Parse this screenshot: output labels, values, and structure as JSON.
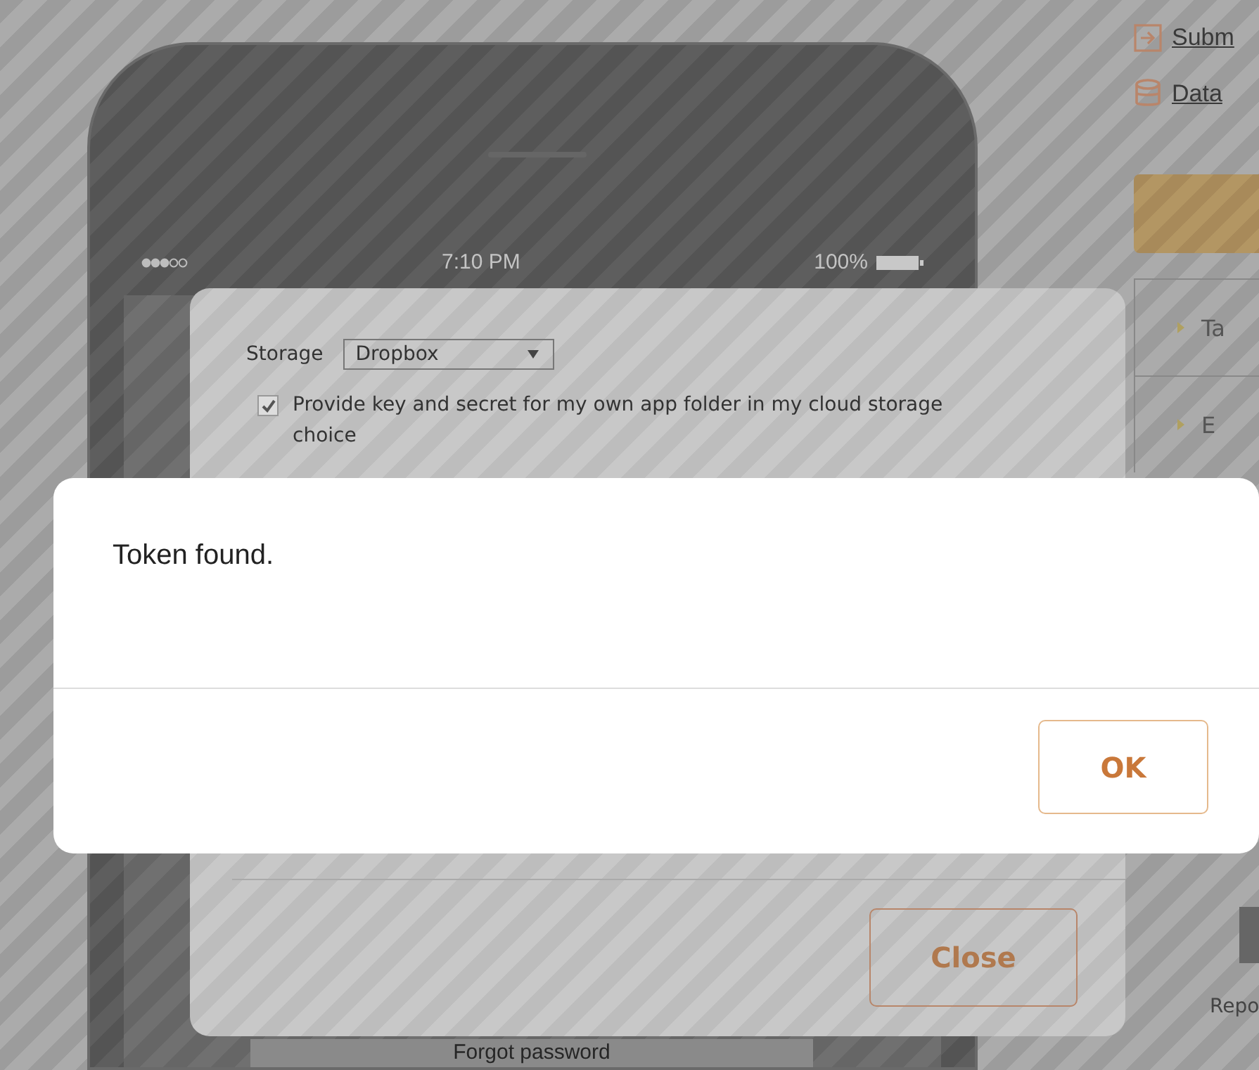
{
  "right_panel": {
    "links": [
      "Subm",
      "Data"
    ],
    "items": [
      "Ta",
      "E"
    ],
    "report_label": "Repo"
  },
  "phone": {
    "status_bar": {
      "time": "7:10 PM",
      "battery": "100%"
    },
    "forgot_password": "Forgot password"
  },
  "settings_dialog": {
    "storage_label": "Storage",
    "storage_value": "Dropbox",
    "own_app_folder": {
      "label": "Provide key and secret for my own app folder in my cloud storage choice",
      "checked": true
    },
    "close_button": "Close"
  },
  "alert": {
    "message": "Token found.",
    "ok_button": "OK"
  }
}
